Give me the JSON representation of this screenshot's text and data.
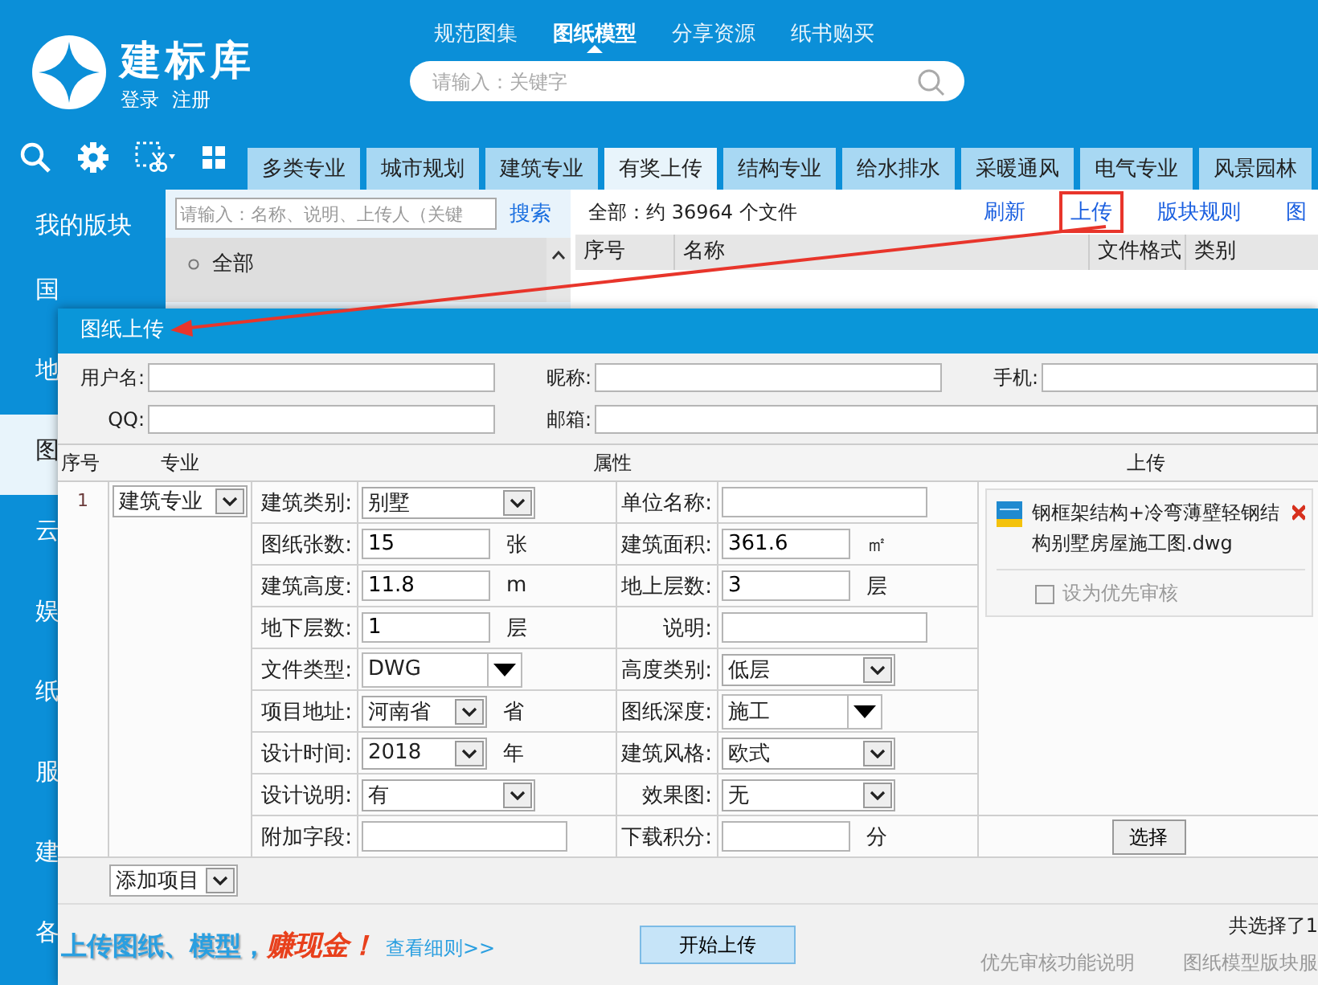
{
  "header": {
    "logo": "建标库",
    "links": [
      {
        "label": "登录"
      },
      {
        "label": "注册"
      }
    ],
    "nav": [
      {
        "label": "规范图集",
        "selected": false
      },
      {
        "label": "图纸模型",
        "selected": true
      },
      {
        "label": "分享资源",
        "selected": false
      },
      {
        "label": "纸书购买",
        "selected": false
      }
    ],
    "search": {
      "placeholder": "请输入：关键字"
    }
  },
  "tabs": [
    {
      "label": "多类专业",
      "selected": false
    },
    {
      "label": "城市规划",
      "selected": false
    },
    {
      "label": "建筑专业",
      "selected": false
    },
    {
      "label": "有奖上传",
      "selected": true
    },
    {
      "label": "结构专业",
      "selected": false
    },
    {
      "label": "给水排水",
      "selected": false
    },
    {
      "label": "采暖通风",
      "selected": false
    },
    {
      "label": "电气专业",
      "selected": false
    },
    {
      "label": "风景园林",
      "selected": false
    }
  ],
  "sidebar": {
    "items": [
      {
        "label": "我的版块",
        "selected": false
      },
      {
        "label": "国",
        "selected": false
      },
      {
        "label": "地",
        "selected": false
      },
      {
        "label": "图",
        "selected": true
      },
      {
        "label": "云",
        "selected": false
      },
      {
        "label": "娱",
        "selected": false
      },
      {
        "label": "纸",
        "selected": false
      },
      {
        "label": "服",
        "selected": false
      },
      {
        "label": "建",
        "selected": false
      },
      {
        "label": "各",
        "selected": false
      }
    ]
  },
  "filter_panel": {
    "search": {
      "placeholder": "请输入：名称、说明、上传人（关键"
    },
    "search_button": "搜索",
    "items": [
      {
        "label": "全部"
      }
    ]
  },
  "file_list": {
    "summary": "全部：约 36964 个文件",
    "actions": [
      {
        "label": "刷新",
        "highlighted": false
      },
      {
        "label": "上传",
        "highlighted": true
      },
      {
        "label": "版块规则",
        "highlighted": false
      },
      {
        "label": "图",
        "highlighted": false
      }
    ],
    "columns": [
      "序号",
      "名称",
      "文件格式",
      "类别"
    ]
  },
  "dialog": {
    "title": "图纸上传",
    "contact_fields": [
      {
        "label": "用户名:"
      },
      {
        "label": "昵称:"
      },
      {
        "label": "手机:"
      },
      {
        "label": "QQ:"
      },
      {
        "label": "邮箱:"
      }
    ],
    "columns": [
      "序号",
      "专业",
      "属性",
      "上传"
    ],
    "item": {
      "index": "1",
      "specialty": "建筑专业",
      "attribute_rows": [
        {
          "left": {
            "label": "建筑类别:",
            "kind": "select",
            "value": "别墅"
          },
          "right": {
            "label": "单位名称:",
            "kind": "input"
          }
        },
        {
          "left": {
            "label": "图纸张数:",
            "kind": "input",
            "value": "15",
            "unit": "张"
          },
          "right": {
            "label": "建筑面积:",
            "kind": "input",
            "value": "361.6",
            "unit": "㎡"
          }
        },
        {
          "left": {
            "label": "建筑高度:",
            "kind": "input",
            "value": "11.8",
            "unit": "m"
          },
          "right": {
            "label": "地上层数:",
            "kind": "input",
            "value": "3",
            "unit": "层"
          }
        },
        {
          "left": {
            "label": "地下层数:",
            "kind": "input",
            "value": "1",
            "unit": "层"
          },
          "right": {
            "label": "说明:",
            "kind": "input"
          }
        },
        {
          "left": {
            "label": "文件类型:",
            "kind": "combo",
            "value": "DWG"
          },
          "right": {
            "label": "高度类别:",
            "kind": "select",
            "value": "低层"
          }
        },
        {
          "left": {
            "label": "项目地址:",
            "kind": "select",
            "value": "河南省",
            "unit": "省"
          },
          "right": {
            "label": "图纸深度:",
            "kind": "combo",
            "value": "施工"
          }
        },
        {
          "left": {
            "label": "设计时间:",
            "kind": "select",
            "value": "2018",
            "unit": "年"
          },
          "right": {
            "label": "建筑风格:",
            "kind": "select",
            "value": "欧式"
          }
        },
        {
          "left": {
            "label": "设计说明:",
            "kind": "select",
            "value": "有"
          },
          "right": {
            "label": "效果图:",
            "kind": "select",
            "value": "无"
          }
        },
        {
          "left": {
            "label": "附加字段:",
            "kind": "input"
          },
          "right": {
            "label": "下载积分:",
            "kind": "input",
            "unit": "分"
          }
        }
      ],
      "file": {
        "name": "钢框架结构+冷弯薄壁轻钢结构别墅房屋施工图.dwg",
        "priority_label": "设为优先审核",
        "priority_checked": false,
        "priority_disabled": true
      },
      "choose_button": "选择"
    },
    "add_select": "添加项目",
    "promo": {
      "lead": "上传图纸、模型，",
      "highlight": "赚现金！",
      "link": "查看细则>>"
    },
    "start_button": "开始上传",
    "selected_count": "共选择了1",
    "links": [
      "优先审核功能说明",
      "图纸模型版块服"
    ]
  }
}
